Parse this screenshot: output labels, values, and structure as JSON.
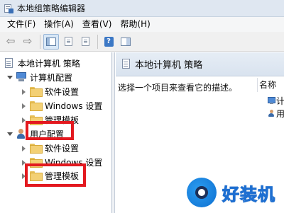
{
  "window": {
    "title": "本地组策略编辑器"
  },
  "menubar": [
    {
      "label": "文件(F)"
    },
    {
      "label": "操作(A)"
    },
    {
      "label": "查看(V)"
    },
    {
      "label": "帮助(H)"
    }
  ],
  "toolbar": {
    "back_icon": "back-arrow-icon",
    "forward_icon": "forward-arrow-icon",
    "help_label": "?"
  },
  "tree": {
    "root": "本地计算机 策略",
    "computer_config": "计算机配置",
    "computer_children": [
      "软件设置",
      "Windows 设置",
      "管理模板"
    ],
    "user_config": "用户配置",
    "user_children": [
      "软件设置",
      "Windows 设置",
      "管理模板"
    ]
  },
  "main": {
    "title": "本地计算机 策略",
    "description": "选择一个项目来查看它的描述。",
    "column_name": "名称",
    "rows": [
      "计",
      "用"
    ]
  },
  "watermark": {
    "text": "好装机"
  },
  "colors": {
    "highlight_box": "#e3191f",
    "accent": "#3c78c5"
  }
}
